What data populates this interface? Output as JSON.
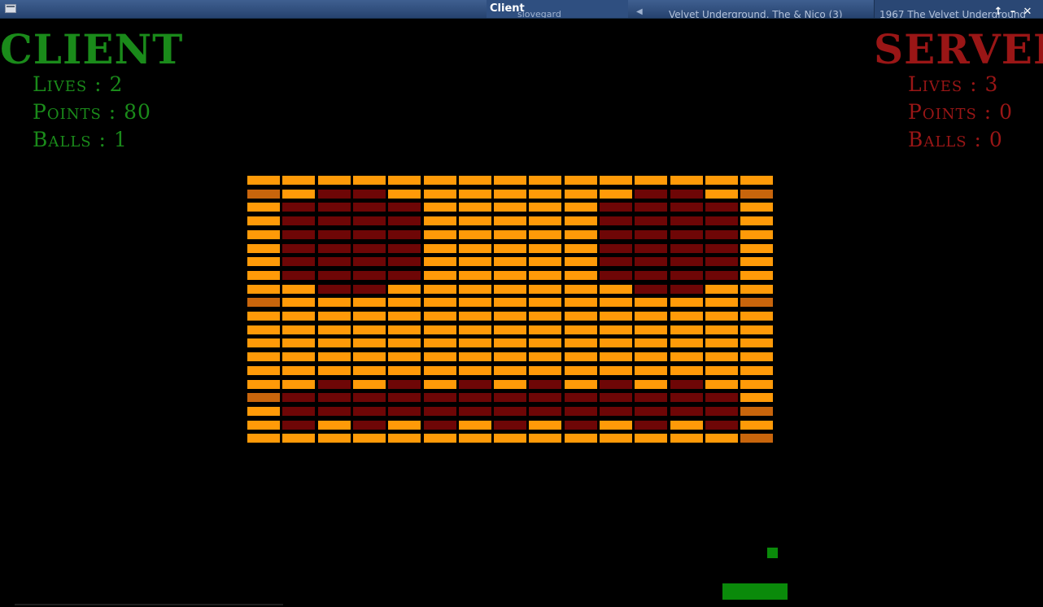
{
  "window": {
    "title": "Client",
    "taskbar": [
      {
        "label": "Client",
        "sub": "slovegard"
      },
      {
        "label": "Velvet Underground, The & Nico (3)"
      },
      {
        "label": "1967 The Velvet Underground"
      }
    ],
    "buttons": [
      "↑",
      "–",
      "✕"
    ]
  },
  "client": {
    "title": "CLIENT",
    "lives": "Lives : 2",
    "points": "Points : 80",
    "balls": "Balls : 1"
  },
  "server": {
    "title": "SERVER",
    "lives": "Lives : 3",
    "points": "Points : 0",
    "balls": "Balls : 0"
  },
  "colors": {
    "orange": "#ff9a08",
    "dark": "#6e0606",
    "amber": "#c8650c",
    "client": "#1a8a1a",
    "server": "#9a1616",
    "paddle": "#0a8a0a"
  },
  "legend": {
    "O": "orange brick",
    "D": "dark brick",
    "B": "amber brick"
  },
  "bricks": [
    "OOOOOOOOOOOOOOO",
    "BODDOOOOOOODDOB",
    "ODDDDOOOOODDDDO",
    "ODDDDOOOOODDDDO",
    "ODDDDOOOOODDDDO",
    "ODDDDOOOOODDDDO",
    "ODDDDOOOOODDDDO",
    "ODDDDOOOOODDDDO",
    "OODDOOOOOOODDOO",
    "BOOOOOOOOOOOOOB",
    "OOOOOOOOOOOOOOO",
    "OOOOOOOOOOOOOOO",
    "OOOOOOOOOOOOOOO",
    "OOOOOOOOOOOOOOO",
    "OOOOOOOOOOOOOOO",
    "OODODODODODODOO",
    "BDDDDDDDDDDDDDO",
    "ODDDDDDDDDDDDDB",
    "ODODODODODODODO",
    "OOOOOOOOOOOOOOB"
  ]
}
